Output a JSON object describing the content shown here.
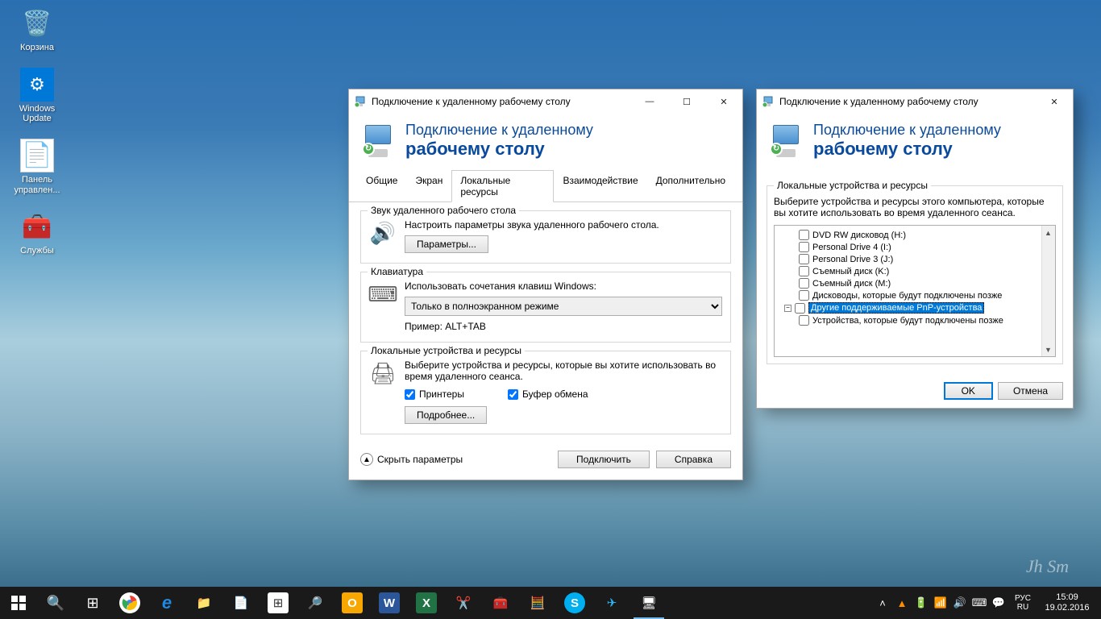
{
  "desktop": {
    "icons": [
      {
        "label": "Корзина",
        "glyph": "🗑"
      },
      {
        "label": "Windows Update",
        "glyph": "⚙"
      },
      {
        "label": "Панель управлен...",
        "glyph": "📄"
      },
      {
        "label": "Службы",
        "glyph": "🧰"
      }
    ]
  },
  "win1": {
    "title": "Подключение к удаленному рабочему столу",
    "header_line1": "Подключение к удаленному",
    "header_line2": "рабочему столу",
    "tabs": [
      "Общие",
      "Экран",
      "Локальные ресурсы",
      "Взаимодействие",
      "Дополнительно"
    ],
    "active_tab": 2,
    "audio": {
      "legend": "Звук удаленного рабочего стола",
      "desc": "Настроить параметры звука удаленного рабочего стола.",
      "button": "Параметры..."
    },
    "keyboard": {
      "legend": "Клавиатура",
      "desc": "Использовать сочетания клавиш Windows:",
      "select": "Только в полноэкранном режиме",
      "example": "Пример: ALT+TAB"
    },
    "local": {
      "legend": "Локальные устройства и ресурсы",
      "desc": "Выберите устройства и ресурсы, которые вы хотите использовать во время удаленного сеанса.",
      "cb1": "Принтеры",
      "cb2": "Буфер обмена",
      "button": "Подробнее..."
    },
    "collapse": "Скрыть параметры",
    "connect": "Подключить",
    "help": "Справка"
  },
  "win2": {
    "title": "Подключение к удаленному рабочему столу",
    "header_line1": "Подключение к удаленному",
    "header_line2": "рабочему столу",
    "box_legend": "Локальные устройства и ресурсы",
    "box_desc": "Выберите устройства и ресурсы этого компьютера, которые вы хотите использовать во время удаленного сеанса.",
    "tree": [
      "DVD RW дисковод (H:)",
      "Personal Drive 4 (I:)",
      "Personal Drive 3 (J:)",
      "Съемный диск (K:)",
      "Съемный диск (M:)",
      "Дисководы, которые будут подключены позже"
    ],
    "tree_branch": "Другие поддерживаемые PnP-устройства",
    "tree_sub": "Устройства, которые будут подключены позже",
    "ok": "OK",
    "cancel": "Отмена"
  },
  "taskbar": {
    "lang1": "РУС",
    "lang2": "RU",
    "time": "15:09",
    "date": "19.02.2016"
  }
}
